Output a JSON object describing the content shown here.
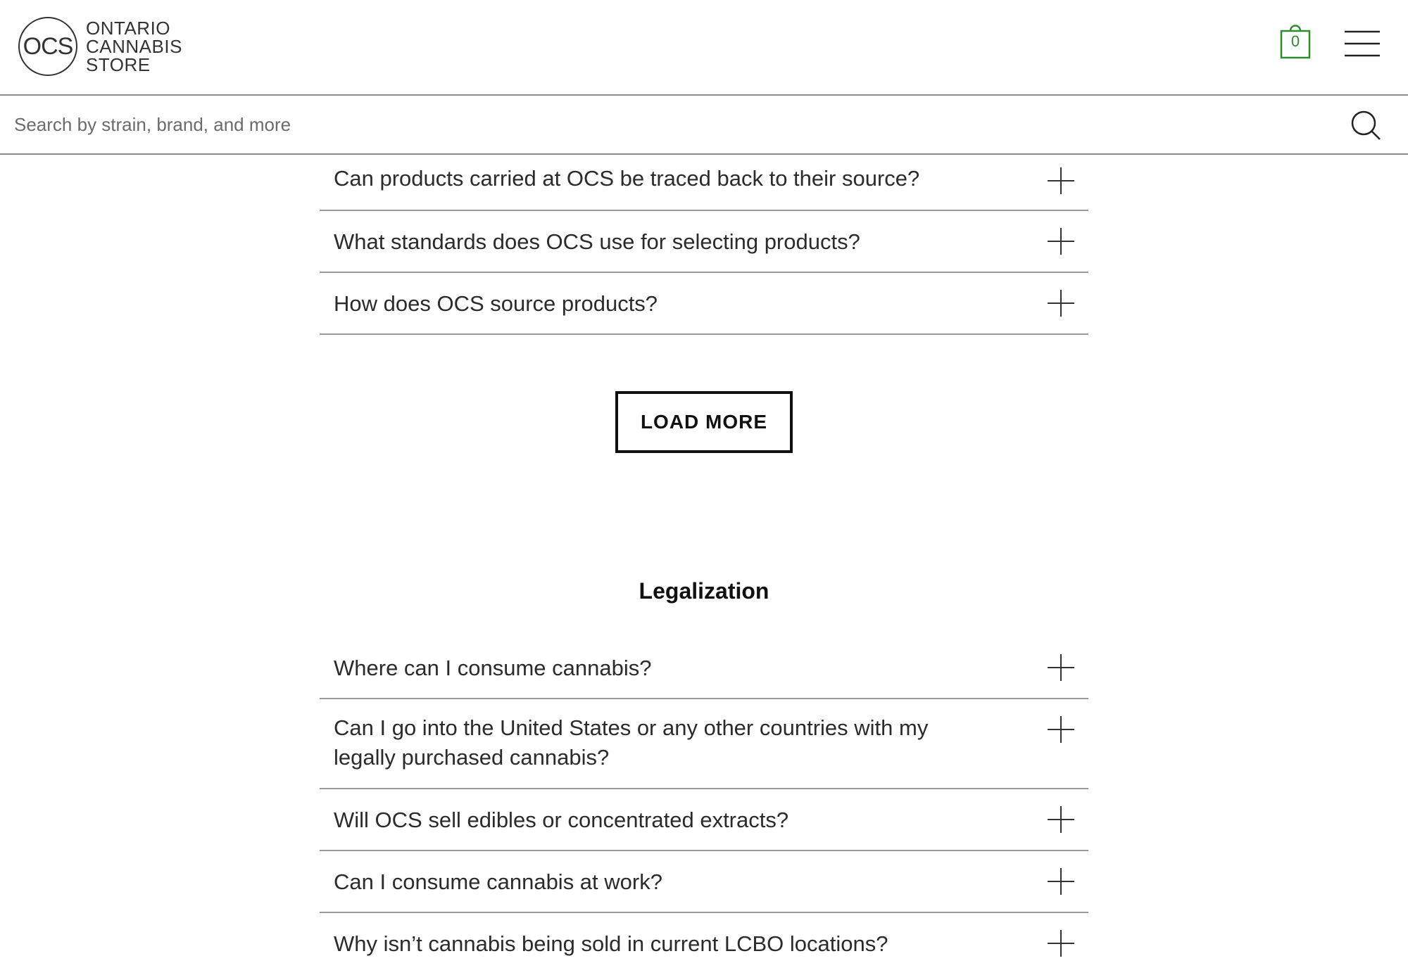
{
  "header": {
    "logo_mark": "OCS",
    "logo_lines": [
      "ONTARIO",
      "CANNABIS",
      "STORE"
    ],
    "cart_count": "0"
  },
  "search": {
    "placeholder": "Search by strain, brand, and more"
  },
  "faq_top": [
    {
      "question": "Can products carried at OCS be traced back to their source?"
    },
    {
      "question": "What standards does OCS use for selecting products?"
    },
    {
      "question": "How does OCS source products?"
    }
  ],
  "load_more_label": "LOAD MORE",
  "legalization": {
    "title": "Legalization",
    "items": [
      {
        "question": "Where can I consume cannabis?"
      },
      {
        "question": "Can I go into the United States or any other countries with my legally purchased cannabis?"
      },
      {
        "question": "Will OCS sell edibles or concentrated extracts?"
      },
      {
        "question": "Can I consume cannabis at work?"
      },
      {
        "question": "Why isn’t cannabis being sold in current LCBO locations?"
      }
    ]
  },
  "colors": {
    "cart_accent": "#2e8b2e",
    "divider": "#9a9a9a",
    "text": "#2b2b2b"
  }
}
